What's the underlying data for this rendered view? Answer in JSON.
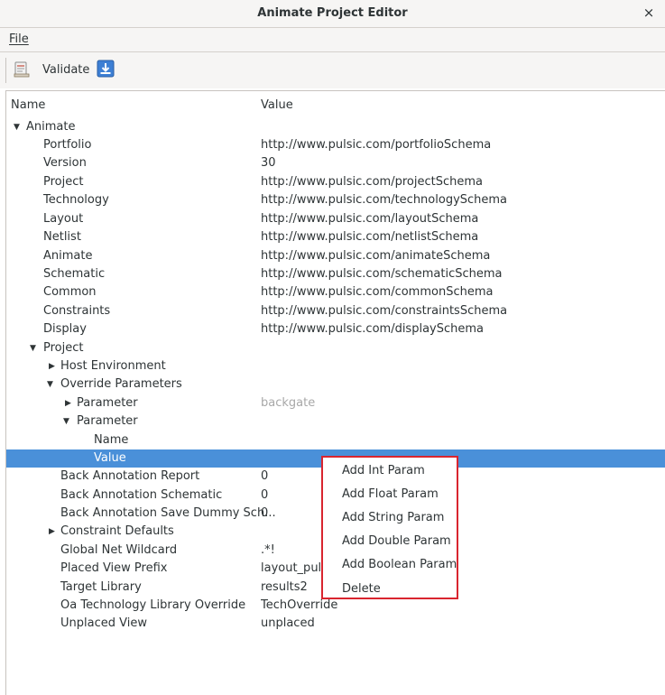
{
  "window": {
    "title": "Animate Project Editor",
    "close_glyph": "×"
  },
  "menubar": {
    "file": "File"
  },
  "toolbar": {
    "validate_label": "Validate",
    "validate_icon": "validate-icon",
    "export_icon": "export-icon"
  },
  "tree": {
    "headers": {
      "name": "Name",
      "value": "Value"
    },
    "rows": [
      {
        "name": "Animate",
        "value": "",
        "arrow": "▼"
      },
      {
        "name": "Portfolio",
        "value": "http://www.pulsic.com/portfolioSchema",
        "arrow": ""
      },
      {
        "name": "Version",
        "value": "30",
        "arrow": ""
      },
      {
        "name": "Project",
        "value": "http://www.pulsic.com/projectSchema",
        "arrow": ""
      },
      {
        "name": "Technology",
        "value": "http://www.pulsic.com/technologySchema",
        "arrow": ""
      },
      {
        "name": "Layout",
        "value": "http://www.pulsic.com/layoutSchema",
        "arrow": ""
      },
      {
        "name": "Netlist",
        "value": "http://www.pulsic.com/netlistSchema",
        "arrow": ""
      },
      {
        "name": "Animate",
        "value": "http://www.pulsic.com/animateSchema",
        "arrow": ""
      },
      {
        "name": "Schematic",
        "value": "http://www.pulsic.com/schematicSchema",
        "arrow": ""
      },
      {
        "name": "Common",
        "value": "http://www.pulsic.com/commonSchema",
        "arrow": ""
      },
      {
        "name": "Constraints",
        "value": "http://www.pulsic.com/constraintsSchema",
        "arrow": ""
      },
      {
        "name": "Display",
        "value": "http://www.pulsic.com/displaySchema",
        "arrow": ""
      },
      {
        "name": "Project",
        "value": "",
        "arrow": "▼"
      },
      {
        "name": "Host Environment",
        "value": "",
        "arrow": "▶"
      },
      {
        "name": "Override Parameters",
        "value": "",
        "arrow": "▼"
      },
      {
        "name": "Parameter",
        "value": "backgate",
        "arrow": "▶"
      },
      {
        "name": "Parameter",
        "value": "",
        "arrow": "▼"
      },
      {
        "name": "Name",
        "value": "",
        "arrow": ""
      },
      {
        "name": "Value",
        "value": "",
        "arrow": ""
      },
      {
        "name": "Back Annotation Report",
        "value": "0",
        "arrow": ""
      },
      {
        "name": "Back Annotation Schematic",
        "value": "0",
        "arrow": ""
      },
      {
        "name": "Back Annotation Save Dummy Sch...",
        "value": "0",
        "arrow": ""
      },
      {
        "name": "Constraint Defaults",
        "value": "",
        "arrow": "▶"
      },
      {
        "name": "Global Net Wildcard",
        "value": ".*!",
        "arrow": ""
      },
      {
        "name": "Placed View Prefix",
        "value": "layout_puls",
        "arrow": ""
      },
      {
        "name": "Target Library",
        "value": "results2",
        "arrow": ""
      },
      {
        "name": "Oa Technology Library Override",
        "value": "TechOverride",
        "arrow": ""
      },
      {
        "name": "Unplaced View",
        "value": "unplaced",
        "arrow": ""
      }
    ]
  },
  "context_menu": {
    "items": [
      "Add Int Param",
      "Add Float Param",
      "Add String Param",
      "Add Double Param",
      "Add Boolean Param",
      "Delete"
    ],
    "border_color": "#d9252f"
  },
  "colors": {
    "selection": "#4a90d9"
  }
}
